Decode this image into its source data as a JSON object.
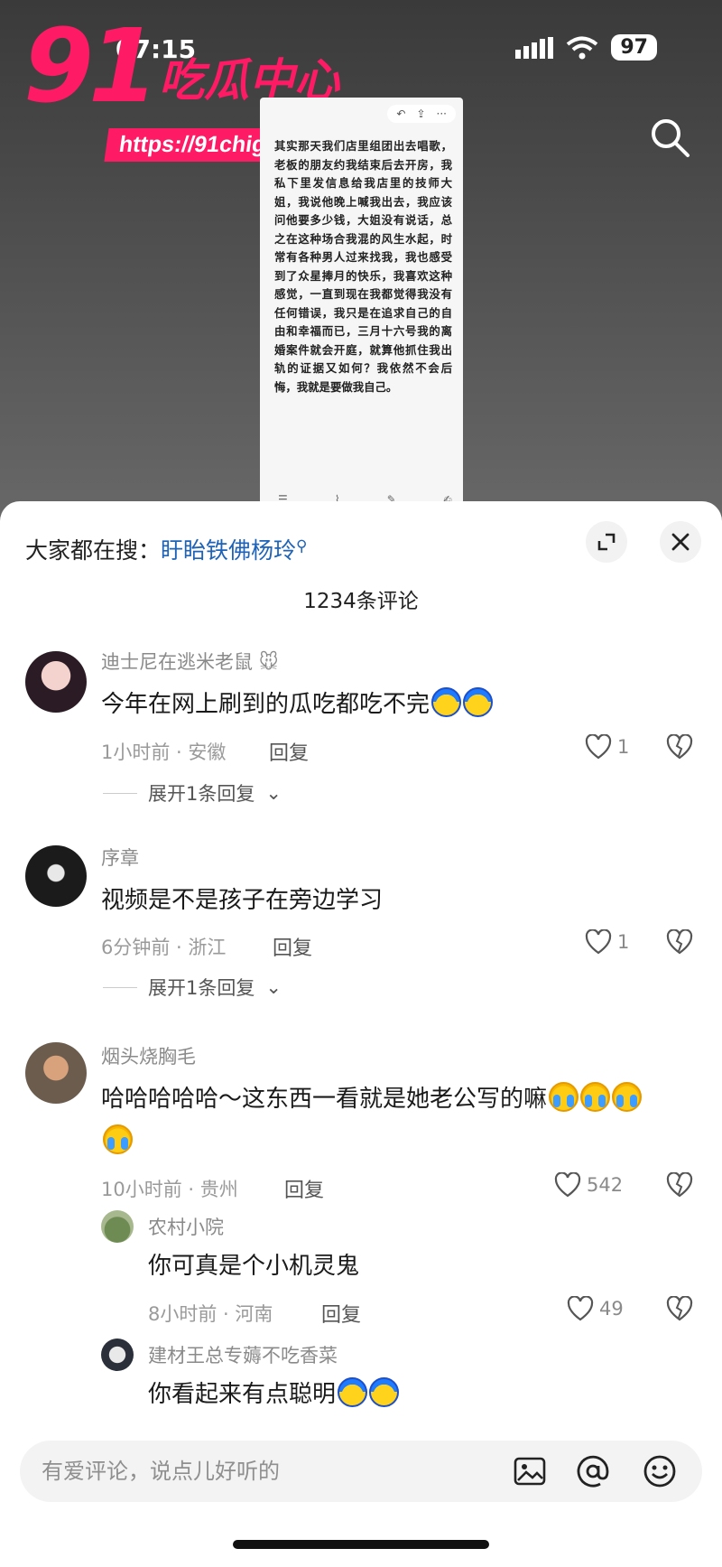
{
  "status_bar": {
    "time": "07:15",
    "battery": "97"
  },
  "watermark": {
    "number": "91",
    "title": "吃瓜中心",
    "url": "https://91chigua19.com"
  },
  "screenshot_text": "其实那天我们店里组团出去唱歌，老板的朋友约我结束后去开房，我私下里发信息给我店里的技师大姐，我说他晚上喊我出去，我应该问他要多少钱，大姐没有说话，总之在这种场合我混的风生水起，时常有各种男人过来找我，我也感受到了众星捧月的快乐，我喜欢这种感觉，一直到现在我都觉得我没有任何错误，我只是在追求自己的自由和幸福而已，三月十六号我的离婚案件就会开庭，就算他抓住我出轨的证据又如何？我依然不会后悔，我就是要做我自己。",
  "sheet": {
    "search_label": "大家都在搜：",
    "search_link": "盱眙铁佛杨玲",
    "comment_count": "1234条评论"
  },
  "comments": [
    {
      "name": "迪士尼在逃米老鼠",
      "text": "今年在网上刷到的瓜吃都吃不完",
      "meta": "1小时前 · 安徽",
      "reply": "回复",
      "likes": "1",
      "expand": "展开1条回复"
    },
    {
      "name": "序章",
      "text": "视频是不是孩子在旁边学习",
      "meta": "6分钟前 · 浙江",
      "reply": "回复",
      "likes": "1",
      "expand": "展开1条回复"
    },
    {
      "name": "烟头烧胸毛",
      "text": "哈哈哈哈哈～这东西一看就是她老公写的嘛",
      "meta": "10小时前 · 贵州",
      "reply": "回复",
      "likes": "542"
    }
  ],
  "replies": [
    {
      "name": "农村小院",
      "text": "你可真是个小机灵鬼",
      "meta": "8小时前 · 河南",
      "reply": "回复",
      "likes": "49"
    },
    {
      "name": "建材王总专薅不吃香菜",
      "text": "你看起来有点聪明"
    }
  ],
  "input": {
    "placeholder": "有爱评论，说点儿好听的"
  },
  "colors": {
    "watermark_pink": "#ff1a66",
    "link_blue": "#1e63b8"
  }
}
